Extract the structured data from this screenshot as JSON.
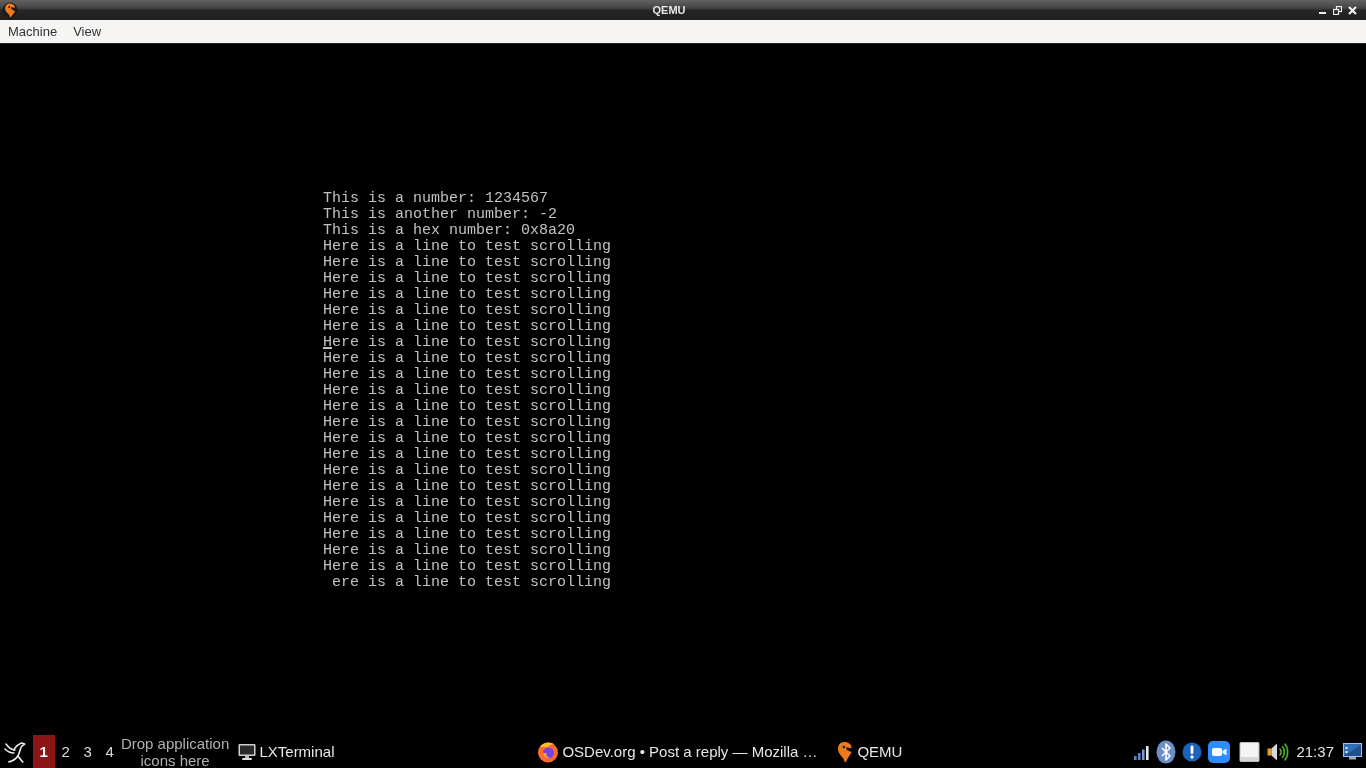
{
  "window": {
    "title": "QEMU"
  },
  "menu_bar": [
    "Machine",
    "View"
  ],
  "console": {
    "lines": [
      {
        "text": "This is a number: 1234567",
        "cursor": false
      },
      {
        "text": "This is another number: -2",
        "cursor": false
      },
      {
        "text": "This is a hex number: 0x8a20",
        "cursor": false
      },
      {
        "text": "Here is a line to test scrolling",
        "cursor": false
      },
      {
        "text": "Here is a line to test scrolling",
        "cursor": false
      },
      {
        "text": "Here is a line to test scrolling",
        "cursor": false
      },
      {
        "text": "Here is a line to test scrolling",
        "cursor": false
      },
      {
        "text": "Here is a line to test scrolling",
        "cursor": false
      },
      {
        "text": "Here is a line to test scrolling",
        "cursor": false
      },
      {
        "text": "Here is a line to test scrolling",
        "cursor": true
      },
      {
        "text": "Here is a line to test scrolling",
        "cursor": false
      },
      {
        "text": "Here is a line to test scrolling",
        "cursor": false
      },
      {
        "text": "Here is a line to test scrolling",
        "cursor": false
      },
      {
        "text": "Here is a line to test scrolling",
        "cursor": false
      },
      {
        "text": "Here is a line to test scrolling",
        "cursor": false
      },
      {
        "text": "Here is a line to test scrolling",
        "cursor": false
      },
      {
        "text": "Here is a line to test scrolling",
        "cursor": false
      },
      {
        "text": "Here is a line to test scrolling",
        "cursor": false
      },
      {
        "text": "Here is a line to test scrolling",
        "cursor": false
      },
      {
        "text": "Here is a line to test scrolling",
        "cursor": false
      },
      {
        "text": "Here is a line to test scrolling",
        "cursor": false
      },
      {
        "text": "Here is a line to test scrolling",
        "cursor": false
      },
      {
        "text": "Here is a line to test scrolling",
        "cursor": false
      },
      {
        "text": "Here is a line to test scrolling",
        "cursor": false
      },
      {
        "text": " ere is a line to test scrolling",
        "cursor": false
      }
    ]
  },
  "taskbar": {
    "desktops": [
      {
        "label": "1",
        "selected": true
      },
      {
        "label": "2",
        "selected": false
      },
      {
        "label": "3",
        "selected": false
      },
      {
        "label": "4",
        "selected": false
      }
    ],
    "launcher_hint": "Drop application icons here",
    "tasks": [
      {
        "label": "LXTerminal",
        "kind": "terminal"
      },
      {
        "label": "OSDev.org • Post a reply — Mozilla …",
        "kind": "browser"
      },
      {
        "label": "QEMU",
        "kind": "emulator"
      }
    ],
    "clock": "21:37"
  }
}
